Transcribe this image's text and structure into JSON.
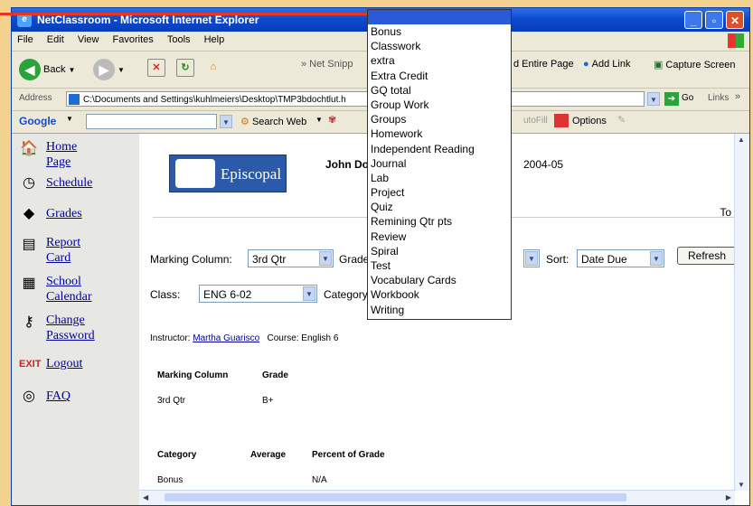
{
  "window": {
    "title": "NetClassroom - Microsoft Internet Explorer"
  },
  "menu": [
    "File",
    "Edit",
    "View",
    "Favorites",
    "Tools",
    "Help"
  ],
  "toolbar": {
    "back": "Back",
    "net_snip": "Net Snipp",
    "add_entire_page": "d Entire Page",
    "add_link": "Add Link",
    "capture_screen": "Capture Screen"
  },
  "address": {
    "label": "Address",
    "url": "C:\\Documents and Settings\\kuhlmeiers\\Desktop\\TMP3bdochtlut.h",
    "go": "Go",
    "links": "Links"
  },
  "google": {
    "label": "Google",
    "search_web": "Search Web",
    "autofill": "utoFill",
    "options": "Options"
  },
  "sidebar": {
    "home": [
      "Home",
      "Page"
    ],
    "schedule": "Schedule",
    "grades": "Grades",
    "report": [
      "Report",
      "Card"
    ],
    "calendar": [
      "School",
      "Calendar"
    ],
    "password": [
      "Change",
      "Password"
    ],
    "logout": "Logout",
    "faq": "FAQ"
  },
  "header": {
    "logo_text": "Episcopal",
    "user": "John Doe,",
    "year": "2004-05",
    "to": "To"
  },
  "filters": {
    "marking_label": "Marking Column:",
    "marking_value": "3rd Qtr",
    "grade_label": "Grade",
    "sort_label": "Sort:",
    "sort_value": "Date Due",
    "refresh": "Refresh",
    "class_label": "Class:",
    "class_value": "ENG 6-02",
    "category_label": "Category:"
  },
  "instructor": {
    "label": "Instructor:",
    "name": "Martha Guarisco",
    "course": "Course: English 6"
  },
  "grades_table": {
    "col1": "Marking Column",
    "col2": "Grade",
    "row_col": "3rd Qtr",
    "row_grade": "B+"
  },
  "category_table": {
    "col1": "Category",
    "col2": "Average",
    "col3": "Percent of Grade",
    "row_cat": "Bonus",
    "row_pct": "N/A"
  },
  "category_dropdown": [
    "Bonus",
    "Classwork",
    "extra",
    "Extra Credit",
    "GQ total",
    "Group Work",
    "Groups",
    "Homework",
    "Independent Reading",
    "Journal",
    "Lab",
    "Project",
    "Quiz",
    "Remining Qtr pts",
    "Review",
    "Spiral",
    "Test",
    "Vocabulary Cards",
    "Workbook",
    "Writing"
  ]
}
